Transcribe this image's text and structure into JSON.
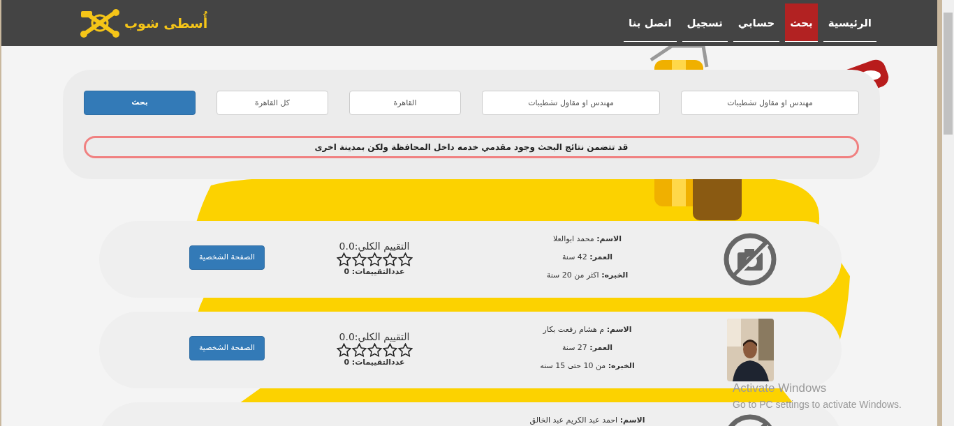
{
  "brand": {
    "name": "أُسطى شوب"
  },
  "nav": [
    {
      "label": "الرئيسية",
      "selected": false
    },
    {
      "label": "بحث",
      "selected": true
    },
    {
      "label": "حسابي",
      "selected": false
    },
    {
      "label": "تسجيل",
      "selected": false
    },
    {
      "label": "اتصل بنا",
      "selected": false
    }
  ],
  "search": {
    "fields": [
      {
        "value": "مهندس او مقاول تشطيبات"
      },
      {
        "value": "مهندس او مقاول تشطيبات"
      },
      {
        "value": "القاهرة"
      },
      {
        "value": "كل القاهرة"
      }
    ],
    "button": "بحث",
    "notice": "قد تتضمن نتائج البحث وجود مقدمي خدمه داخل المحافظة ولكن بمدينة اخرى"
  },
  "results": [
    {
      "kind": "placeholder",
      "lines": [
        "**الاسم:** محمد ابوالعلا",
        "**العمر:** 42 سنة",
        "**الخبره:** اكثر من 20 سنة"
      ],
      "rating": "التقييم الكلي:0.0",
      "stars": 0,
      "count": "عددالتقييمات: 0",
      "button": "الصفحة الشخصية"
    },
    {
      "kind": "picture",
      "lines": [
        "**الاسم:** م هشام رفعت بكار",
        "**العمر:** 27 سنة",
        "**الخبره:** من 10 حتى 15 سنه"
      ],
      "rating": "التقييم الكلي:0.0",
      "stars": 0,
      "count": "عددالتقييمات: 0",
      "button": "الصفحة الشخصية"
    },
    {
      "kind": "placeholder",
      "lines": [
        "**الاسم:** احمد عبد الكريم عبد الخالق"
      ]
    }
  ],
  "os_notice": {
    "title": "Activate Windows",
    "text": "Go to PC settings to activate Windows."
  }
}
